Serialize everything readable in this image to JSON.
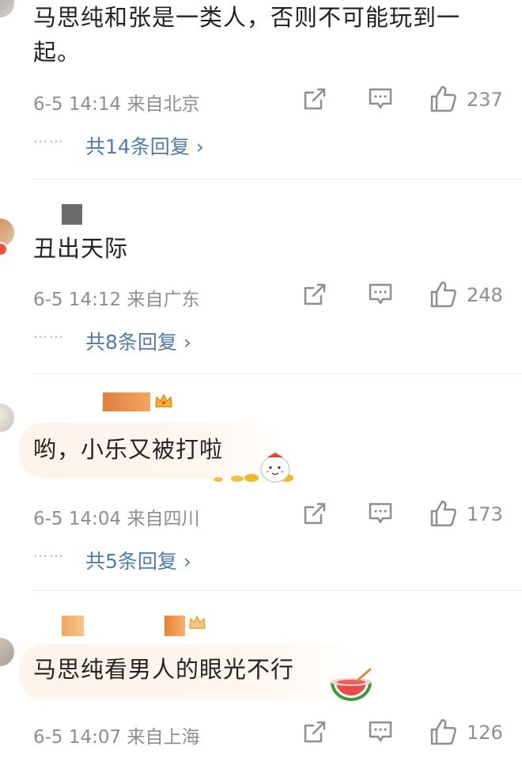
{
  "comments": [
    {
      "text": "马思纯和张是一类人，否则不可能玩到一起。",
      "time_location": "6-5 14:14  来自北京",
      "likes": "237",
      "replies": "共14条回复 ›"
    },
    {
      "text": "丑出天际",
      "time_location": "6-5 14:12  来自广东",
      "likes": "248",
      "replies": "共8条回复 ›"
    },
    {
      "text": "哟，小乐又被打啦",
      "time_location": "6-5 14:04  来自四川",
      "likes": "173",
      "replies": "共5条回复 ›"
    },
    {
      "text": "马思纯看男人的眼光不行",
      "time_location": "6-5 14:07  来自上海",
      "likes": "126"
    }
  ],
  "reply_dots": "……",
  "icons": {
    "share": "share-icon",
    "comment": "comment-icon",
    "like": "thumbs-up-icon"
  },
  "colors": {
    "link": "#4f7cad",
    "meta": "#8e8e8e",
    "text": "#222222",
    "divider": "#e9e9e9"
  }
}
